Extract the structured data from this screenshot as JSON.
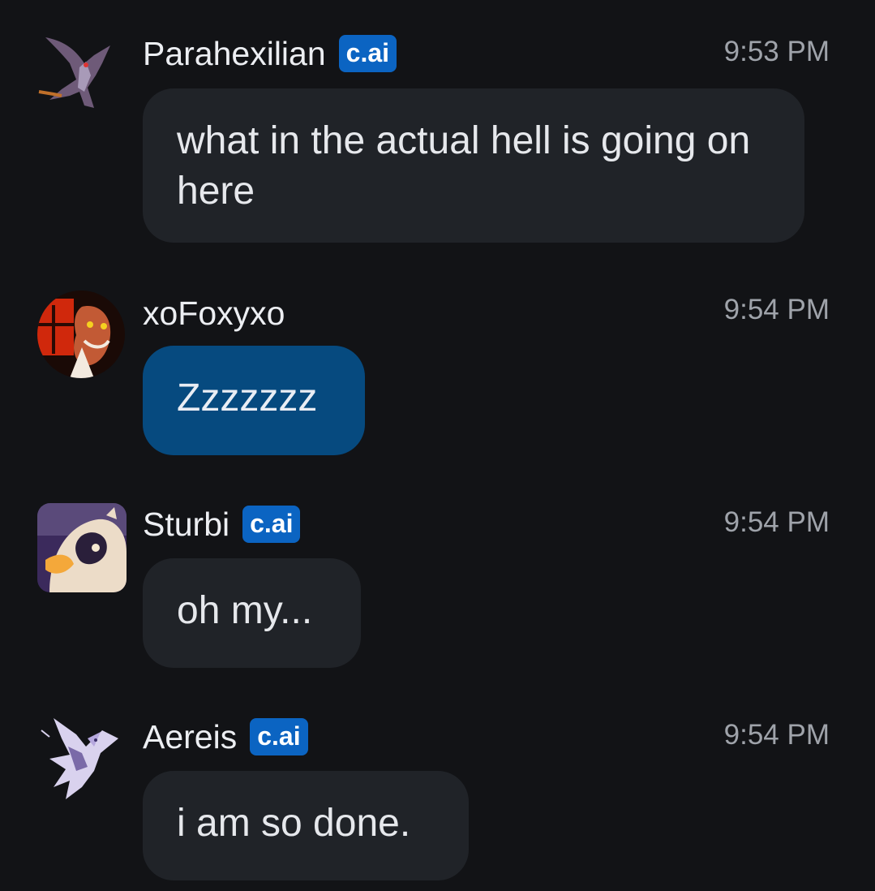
{
  "messages": [
    {
      "username": "Parahexilian",
      "badge": "c.ai",
      "time": "9:53 PM",
      "text": "what in the actual hell is going on here",
      "avatar_icon": "dragon-avatar"
    },
    {
      "username": "xoFoxyxo",
      "badge": "",
      "time": "9:54 PM",
      "text": "Zzzzzzz",
      "avatar_icon": "creature-avatar",
      "is_self": true
    },
    {
      "username": "Sturbi",
      "badge": "c.ai",
      "time": "9:54 PM",
      "text": "oh my...",
      "avatar_icon": "furry-avatar"
    },
    {
      "username": "Aereis",
      "badge": "c.ai",
      "time": "9:54 PM",
      "text": "i am so done.",
      "avatar_icon": "bird-avatar"
    }
  ],
  "colors": {
    "background": "#121316",
    "bubble": "#202328",
    "self_bubble": "#064a7f",
    "badge": "#0b64c2",
    "timestamp": "#9fa3aa"
  }
}
